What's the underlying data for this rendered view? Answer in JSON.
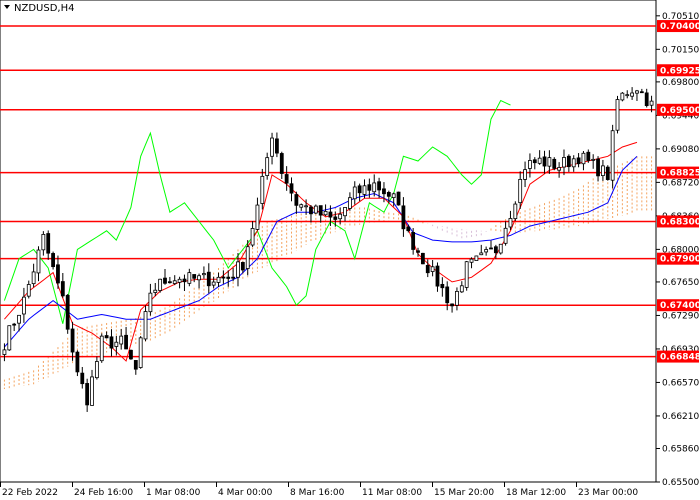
{
  "chart_data": {
    "type": "candlestick",
    "symbol_label": "NZDUSD,H4",
    "y_axis": {
      "ticks": [
        "0.70510",
        "0.70150",
        "0.69800",
        "0.69440",
        "0.69080",
        "0.68720",
        "0.68360",
        "0.68000",
        "0.67650",
        "0.67290",
        "0.66930",
        "0.66570",
        "0.66210",
        "0.65860",
        "0.65500"
      ],
      "range": [
        0.655,
        0.7068
      ]
    },
    "x_axis": {
      "ticks": [
        "22 Feb 2022",
        "24 Feb 16:00",
        "1 Mar 08:00",
        "4 Mar 00:00",
        "8 Mar 16:00",
        "11 Mar 08:00",
        "15 Mar 20:00",
        "18 Mar 12:00",
        "23 Mar 00:00"
      ],
      "bar_count": 134
    },
    "levels": [
      {
        "price": 0.704,
        "label": "0.70400"
      },
      {
        "price": 0.69925,
        "label": "0.69925"
      },
      {
        "price": 0.695,
        "label": "0.69500"
      },
      {
        "price": 0.68825,
        "label": "0.68825"
      },
      {
        "price": 0.683,
        "label": "0.68300"
      },
      {
        "price": 0.679,
        "label": "0.67900"
      },
      {
        "price": 0.674,
        "label": "0.67400"
      },
      {
        "price": 0.66848,
        "label": "0.66848"
      }
    ],
    "close_anchors": [
      [
        0,
        0.67
      ],
      [
        4,
        0.6745
      ],
      [
        8,
        0.6812
      ],
      [
        12,
        0.6745
      ],
      [
        15,
        0.6665
      ],
      [
        17,
        0.664
      ],
      [
        20,
        0.67
      ],
      [
        24,
        0.67
      ],
      [
        27,
        0.667
      ],
      [
        30,
        0.6755
      ],
      [
        34,
        0.677
      ],
      [
        38,
        0.6768
      ],
      [
        42,
        0.6768
      ],
      [
        46,
        0.677
      ],
      [
        49,
        0.6785
      ],
      [
        52,
        0.6845
      ],
      [
        55,
        0.6925
      ],
      [
        57,
        0.6885
      ],
      [
        60,
        0.685
      ],
      [
        64,
        0.684
      ],
      [
        68,
        0.683
      ],
      [
        72,
        0.686
      ],
      [
        76,
        0.687
      ],
      [
        80,
        0.6855
      ],
      [
        83,
        0.6815
      ],
      [
        86,
        0.679
      ],
      [
        89,
        0.6765
      ],
      [
        92,
        0.674
      ],
      [
        95,
        0.678
      ],
      [
        98,
        0.679
      ],
      [
        101,
        0.68
      ],
      [
        104,
        0.684
      ],
      [
        107,
        0.689
      ],
      [
        110,
        0.6895
      ],
      [
        114,
        0.689
      ],
      [
        118,
        0.69
      ],
      [
        121,
        0.689
      ],
      [
        124,
        0.688
      ],
      [
        126,
        0.696
      ],
      [
        128,
        0.697
      ],
      [
        130,
        0.6975
      ],
      [
        133,
        0.6955
      ]
    ],
    "tenkan_anchors": [
      [
        0,
        0.6725
      ],
      [
        5,
        0.6755
      ],
      [
        10,
        0.6775
      ],
      [
        14,
        0.672
      ],
      [
        18,
        0.671
      ],
      [
        22,
        0.6695
      ],
      [
        25,
        0.668
      ],
      [
        28,
        0.6735
      ],
      [
        32,
        0.6755
      ],
      [
        36,
        0.6765
      ],
      [
        40,
        0.6768
      ],
      [
        44,
        0.6768
      ],
      [
        48,
        0.6785
      ],
      [
        52,
        0.682
      ],
      [
        55,
        0.688
      ],
      [
        58,
        0.687
      ],
      [
        62,
        0.685
      ],
      [
        66,
        0.6835
      ],
      [
        70,
        0.684
      ],
      [
        74,
        0.6855
      ],
      [
        78,
        0.6855
      ],
      [
        82,
        0.6835
      ],
      [
        85,
        0.6795
      ],
      [
        88,
        0.678
      ],
      [
        92,
        0.6765
      ],
      [
        96,
        0.677
      ],
      [
        100,
        0.6785
      ],
      [
        104,
        0.682
      ],
      [
        108,
        0.687
      ],
      [
        112,
        0.6885
      ],
      [
        116,
        0.689
      ],
      [
        120,
        0.6895
      ],
      [
        124,
        0.69
      ],
      [
        127,
        0.691
      ],
      [
        130,
        0.6915
      ]
    ],
    "kijun_anchors": [
      [
        0,
        0.6695
      ],
      [
        5,
        0.6725
      ],
      [
        10,
        0.6745
      ],
      [
        15,
        0.6725
      ],
      [
        20,
        0.673
      ],
      [
        25,
        0.6725
      ],
      [
        30,
        0.6725
      ],
      [
        35,
        0.6735
      ],
      [
        40,
        0.6745
      ],
      [
        44,
        0.676
      ],
      [
        48,
        0.677
      ],
      [
        52,
        0.679
      ],
      [
        56,
        0.683
      ],
      [
        60,
        0.684
      ],
      [
        64,
        0.684
      ],
      [
        68,
        0.6845
      ],
      [
        72,
        0.6855
      ],
      [
        76,
        0.686
      ],
      [
        80,
        0.685
      ],
      [
        84,
        0.6818
      ],
      [
        88,
        0.681
      ],
      [
        92,
        0.6808
      ],
      [
        96,
        0.6808
      ],
      [
        100,
        0.681
      ],
      [
        104,
        0.6815
      ],
      [
        108,
        0.6825
      ],
      [
        112,
        0.683
      ],
      [
        116,
        0.6835
      ],
      [
        120,
        0.684
      ],
      [
        124,
        0.685
      ],
      [
        127,
        0.6885
      ],
      [
        130,
        0.69
      ]
    ],
    "chikou_anchors": [
      [
        0,
        0.6745
      ],
      [
        3,
        0.679
      ],
      [
        6,
        0.68
      ],
      [
        9,
        0.678
      ],
      [
        12,
        0.672
      ],
      [
        15,
        0.68
      ],
      [
        18,
        0.681
      ],
      [
        21,
        0.682
      ],
      [
        23,
        0.681
      ],
      [
        26,
        0.6845
      ],
      [
        28,
        0.69
      ],
      [
        30,
        0.6925
      ],
      [
        32,
        0.688
      ],
      [
        34,
        0.684
      ],
      [
        37,
        0.685
      ],
      [
        40,
        0.683
      ],
      [
        43,
        0.681
      ],
      [
        46,
        0.678
      ],
      [
        49,
        0.68
      ],
      [
        52,
        0.682
      ],
      [
        55,
        0.678
      ],
      [
        58,
        0.676
      ],
      [
        60,
        0.674
      ],
      [
        62,
        0.675
      ],
      [
        64,
        0.68
      ],
      [
        67,
        0.683
      ],
      [
        70,
        0.682
      ],
      [
        72,
        0.679
      ],
      [
        75,
        0.685
      ],
      [
        78,
        0.684
      ],
      [
        80,
        0.686
      ],
      [
        82,
        0.69
      ],
      [
        85,
        0.6895
      ],
      [
        88,
        0.691
      ],
      [
        91,
        0.69
      ],
      [
        94,
        0.688
      ],
      [
        96,
        0.687
      ],
      [
        98,
        0.688
      ],
      [
        100,
        0.694
      ],
      [
        102,
        0.696
      ],
      [
        104,
        0.6955
      ]
    ],
    "cloud_a_anchors": [
      [
        0,
        0.666
      ],
      [
        6,
        0.667
      ],
      [
        10,
        0.669
      ],
      [
        15,
        0.6715
      ],
      [
        20,
        0.672
      ],
      [
        26,
        0.6725
      ],
      [
        30,
        0.673
      ],
      [
        34,
        0.674
      ],
      [
        38,
        0.6755
      ],
      [
        42,
        0.677
      ],
      [
        46,
        0.679
      ],
      [
        50,
        0.681
      ],
      [
        54,
        0.683
      ],
      [
        58,
        0.6835
      ],
      [
        62,
        0.684
      ],
      [
        66,
        0.6845
      ],
      [
        70,
        0.6845
      ],
      [
        74,
        0.6845
      ],
      [
        78,
        0.684
      ],
      [
        82,
        0.6838
      ],
      [
        86,
        0.683
      ],
      [
        90,
        0.682
      ],
      [
        94,
        0.6812
      ],
      [
        98,
        0.6815
      ],
      [
        102,
        0.683
      ],
      [
        106,
        0.684
      ],
      [
        110,
        0.6848
      ],
      [
        114,
        0.6855
      ],
      [
        118,
        0.6865
      ],
      [
        122,
        0.688
      ],
      [
        126,
        0.689
      ],
      [
        130,
        0.69
      ]
    ],
    "cloud_b_anchors": [
      [
        0,
        0.665
      ],
      [
        6,
        0.6655
      ],
      [
        10,
        0.6665
      ],
      [
        15,
        0.668
      ],
      [
        20,
        0.6688
      ],
      [
        26,
        0.6695
      ],
      [
        30,
        0.67
      ],
      [
        34,
        0.671
      ],
      [
        38,
        0.6725
      ],
      [
        42,
        0.674
      ],
      [
        46,
        0.6755
      ],
      [
        50,
        0.677
      ],
      [
        54,
        0.6782
      ],
      [
        58,
        0.6792
      ],
      [
        62,
        0.6805
      ],
      [
        66,
        0.6815
      ],
      [
        70,
        0.6822
      ],
      [
        74,
        0.6828
      ],
      [
        78,
        0.683
      ],
      [
        82,
        0.683
      ],
      [
        86,
        0.6828
      ],
      [
        90,
        0.6825
      ],
      [
        94,
        0.6822
      ],
      [
        98,
        0.682
      ],
      [
        102,
        0.6818
      ],
      [
        106,
        0.6818
      ],
      [
        110,
        0.682
      ],
      [
        114,
        0.6822
      ],
      [
        118,
        0.6825
      ],
      [
        122,
        0.683
      ],
      [
        126,
        0.6835
      ],
      [
        130,
        0.684
      ]
    ],
    "colors": {
      "level": "#ff0000",
      "bull": "#ffffff",
      "bear": "#000000",
      "tenkan": "#ff0000",
      "kijun": "#0000ff",
      "chikou": "#00ff00",
      "cloud_up": "#f4a460",
      "cloud_down": "#d8bfd8",
      "grid": "#c0c0c0"
    }
  }
}
